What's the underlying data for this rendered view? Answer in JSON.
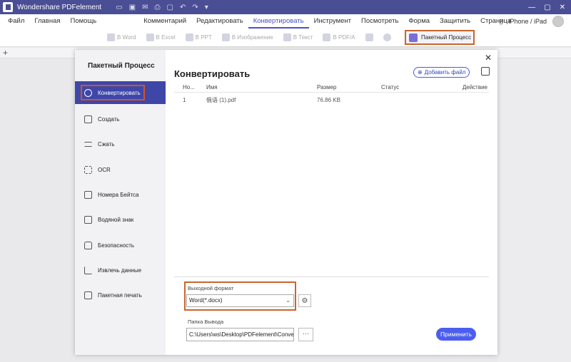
{
  "app": {
    "title": "Wondershare PDFelement"
  },
  "menu": {
    "items": [
      "Файл",
      "Главная",
      "Помощь",
      "Комментарий",
      "Редактировать",
      "Конвертировать",
      "Инструмент",
      "Посмотреть",
      "Форма",
      "Защитить",
      "Страница"
    ],
    "active": "Конвертировать",
    "device": "iPhone / iPad"
  },
  "toolbar": {
    "items": [
      "В Word",
      "В Excel",
      "В PPT",
      "В Изображение",
      "В Текст",
      "В PDF/A"
    ],
    "batch_label": "Пакетный Процесс"
  },
  "modal": {
    "left_title": "Пакетный Процесс",
    "nav": [
      {
        "label": "Конвертировать",
        "icon": "refresh-icon",
        "active": true
      },
      {
        "label": "Создать",
        "icon": "plus-square-icon",
        "active": false
      },
      {
        "label": "Сжать",
        "icon": "compress-icon",
        "active": false
      },
      {
        "label": "OCR",
        "icon": "ocr-scan-icon",
        "active": false
      },
      {
        "label": "Номера Бейтса",
        "icon": "bates-number-icon",
        "active": false
      },
      {
        "label": "Водяной знак",
        "icon": "watermark-icon",
        "active": false
      },
      {
        "label": "Безопасность",
        "icon": "lock-icon",
        "active": false
      },
      {
        "label": "Извлечь данные",
        "icon": "chart-bars-icon",
        "active": false
      },
      {
        "label": "Пакетная печать",
        "icon": "print-icon",
        "active": false
      }
    ],
    "title": "Конвертировать",
    "add_file": "Добавить файл",
    "table": {
      "headers": [
        "Но...",
        "Имя",
        "Размер",
        "Статус",
        "Действие"
      ],
      "rows": [
        {
          "no": "1",
          "name": "俄语 (1).pdf",
          "size": "76.86 KB",
          "status": "",
          "action": ""
        }
      ]
    },
    "output_format_label": "Выходной формат",
    "output_format_value": "Word(*.docx)",
    "output_folder_label": "Папка Вывода",
    "output_folder_value": "C:\\Users\\ws\\Desktop\\PDFelement\\Convert",
    "browse_label": "···",
    "apply": "Применить"
  }
}
